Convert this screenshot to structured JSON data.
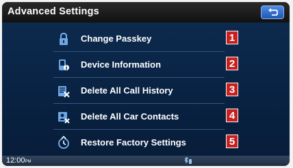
{
  "header": {
    "title": "Advanced Settings",
    "back_icon": "back-arrow-icon"
  },
  "menu": {
    "items": [
      {
        "label": "Change Passkey",
        "icon": "lock-icon",
        "badge": "1"
      },
      {
        "label": "Device Information",
        "icon": "phone-device-icon",
        "badge": "2"
      },
      {
        "label": "Delete All Call History",
        "icon": "call-history-delete-icon",
        "badge": "3"
      },
      {
        "label": "Delete All Car Contacts",
        "icon": "contacts-delete-icon",
        "badge": "4"
      },
      {
        "label": "Restore Factory Settings",
        "icon": "restore-icon",
        "badge": "5"
      }
    ]
  },
  "status": {
    "time": "12:00",
    "ampm": "PM",
    "bluetooth_icon": "bluetooth-status-icon"
  },
  "colors": {
    "header": "#1a1a1a",
    "background": "#0a2547",
    "badge": "#c8201f",
    "back_button": "#2f6fd0"
  }
}
